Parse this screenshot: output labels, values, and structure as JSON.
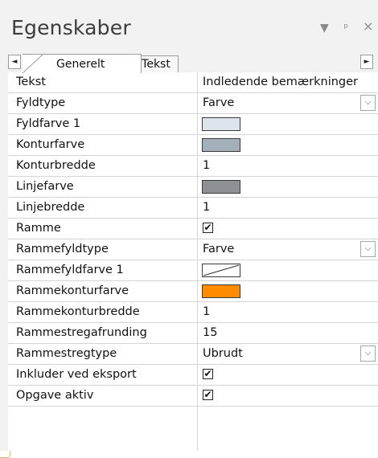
{
  "panel": {
    "title": "Egenskaber",
    "icons": {
      "dropdown": "triangle-down-icon",
      "pin": "pin-icon",
      "close": "close-icon"
    }
  },
  "tabs": [
    {
      "label": "Generelt",
      "active": true
    },
    {
      "label": "Tekst",
      "active": false
    }
  ],
  "scroll": {
    "left_glyph": "◄",
    "right_glyph": "►"
  },
  "properties": [
    {
      "name": "Tekst",
      "kind": "text",
      "value": "Indledende bemærkninger"
    },
    {
      "name": "Fyldtype",
      "kind": "dropdown",
      "value": "Farve"
    },
    {
      "name": "Fyldfarve 1",
      "kind": "color",
      "color": "#dde4ec"
    },
    {
      "name": "Konturfarve",
      "kind": "color",
      "color": "#a3afb9"
    },
    {
      "name": "Konturbredde",
      "kind": "text",
      "value": "1"
    },
    {
      "name": "Linjefarve",
      "kind": "color",
      "color": "#8e9095"
    },
    {
      "name": "Linjebredde",
      "kind": "text",
      "value": "1"
    },
    {
      "name": "Ramme",
      "kind": "checkbox",
      "checked": true
    },
    {
      "name": "Rammefyldtype",
      "kind": "dropdown",
      "value": "Farve"
    },
    {
      "name": "Rammefyldfarve 1",
      "kind": "color-none"
    },
    {
      "name": "Rammekonturfarve",
      "kind": "color",
      "color": "#ff8c00"
    },
    {
      "name": "Rammekonturbredde",
      "kind": "text",
      "value": "1"
    },
    {
      "name": "Rammestregafrunding",
      "kind": "text",
      "value": "15"
    },
    {
      "name": "Rammestregtype",
      "kind": "dropdown",
      "value": "Ubrudt"
    },
    {
      "name": "Inkluder ved eksport",
      "kind": "checkbox",
      "checked": true
    },
    {
      "name": "Opgave aktiv",
      "kind": "checkbox",
      "checked": true
    }
  ],
  "glyphs": {
    "check": "✔",
    "chevron": "⌵"
  }
}
